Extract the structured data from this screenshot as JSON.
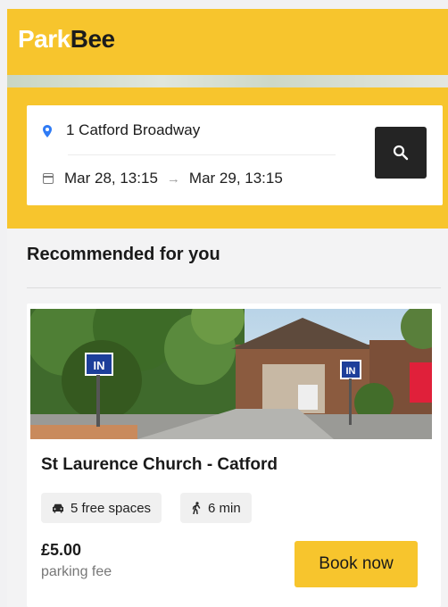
{
  "brand": {
    "logo_part1": "Park",
    "logo_part2": "Bee",
    "accent_color": "#f7c52d"
  },
  "search": {
    "location": "1 Catford Broadway",
    "start": "Mar 28, 13:15",
    "end": "Mar 29, 13:15",
    "arrow": "→",
    "location_icon": "location-pin-icon",
    "date_icon": "calendar-icon",
    "button_icon": "search-icon"
  },
  "recommended": {
    "heading": "Recommended for you",
    "card": {
      "title": "St Laurence Church - Catford",
      "spaces": "5 free spaces",
      "walk": "6 min",
      "price": "£5.00",
      "price_label": "parking fee",
      "book_label": "Book now",
      "sign_left": "IN",
      "sign_right": "IN"
    }
  }
}
